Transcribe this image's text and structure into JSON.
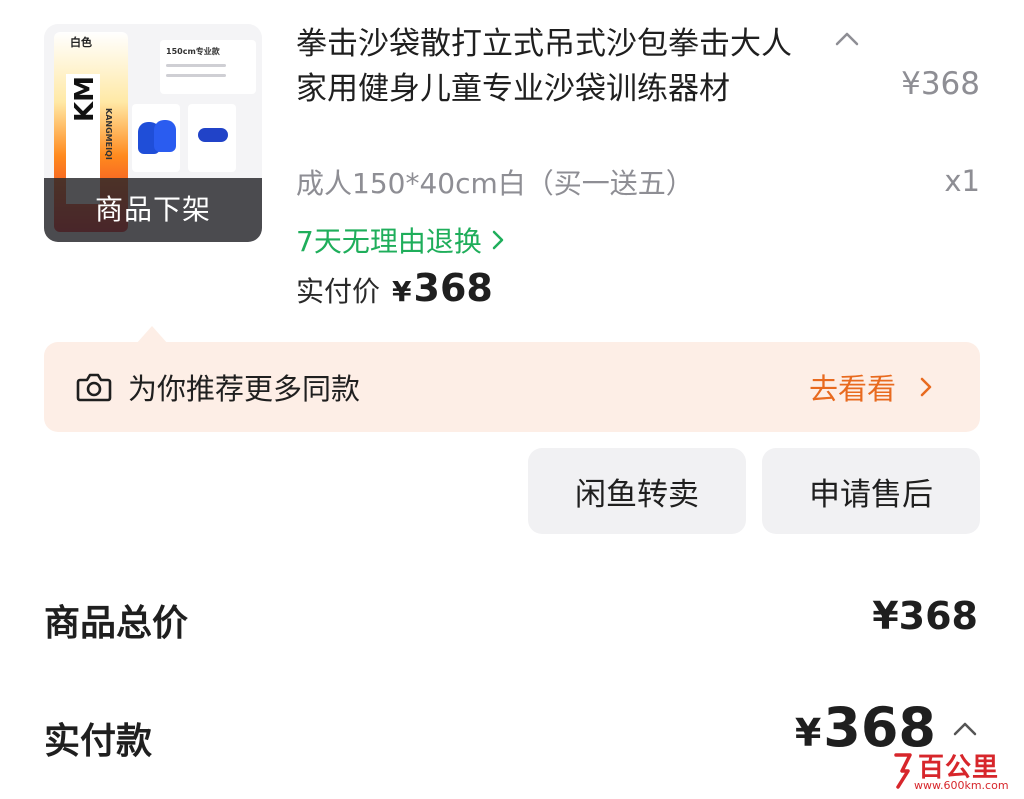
{
  "product": {
    "thumbnail_overlay": "商品下架",
    "thumbnail_color_text": "白色",
    "thumbnail_brand_text": "KANGMEIQI",
    "thumbnail_spec_text": "150cm专业款",
    "title": "拳击沙袋散打立式吊式沙包拳击大人家用健身儿童专业沙袋训练器材",
    "unit_price": "¥368",
    "sku": "成人150*40cm白（买一送五）",
    "quantity": "x1",
    "return_policy": "7天无理由退换",
    "paid_label": "实付价",
    "paid_currency": "¥",
    "paid_amount": "368"
  },
  "recommend": {
    "text": "为你推荐更多同款",
    "action": "去看看"
  },
  "actions": {
    "resell": "闲鱼转卖",
    "after_sale": "申请售后"
  },
  "summary": {
    "total_label": "商品总价",
    "total_value": "¥368",
    "paid_label": "实付款",
    "paid_currency": "¥",
    "paid_amount": "368"
  },
  "watermark": {
    "name": "百公里",
    "url": "www.600km.com"
  },
  "colors": {
    "accent_green": "#1fae5b",
    "accent_orange": "#e86a1f",
    "banner_bg": "#fdeee6",
    "button_bg": "#f1f1f3",
    "muted_text": "#8e8e94",
    "watermark_red": "#d7262b"
  },
  "icons": {
    "collapse": "chevron-up-icon",
    "return": "chevron-right-icon",
    "recommend": "camera-icon",
    "go": "chevron-right-icon"
  }
}
